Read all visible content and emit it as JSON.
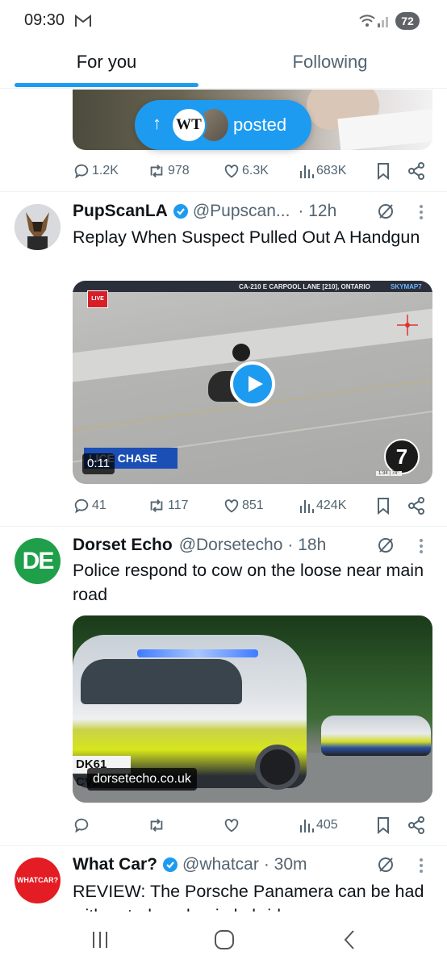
{
  "status_bar": {
    "time": "09:30",
    "battery": "72"
  },
  "tabs": [
    {
      "label": "For you",
      "active": true
    },
    {
      "label": "Following",
      "active": false
    }
  ],
  "posted_pill": {
    "avatar_text": "WT",
    "label": "posted"
  },
  "post0": {
    "replies": "1.2K",
    "reposts": "978",
    "likes": "6.3K",
    "views": "683K"
  },
  "post1": {
    "name": "PupScanLA",
    "handle": "@Pupscan...",
    "time": "· 12h",
    "text": "Replay When Suspect Pulled Out A Handgun",
    "video": {
      "live": "LIVE",
      "caption": "CA-210 E CARPOOL LANE [210], ONTARIO",
      "brand": "SKYMAP7",
      "banner": "LICE CHASE",
      "duration": "0:11",
      "station": "7",
      "station_time": "1:34 | 74°"
    },
    "replies": "41",
    "reposts": "117",
    "likes": "851",
    "views": "424K"
  },
  "post2": {
    "avatar_text": "DE",
    "name": "Dorset Echo",
    "handle": "@Dorsetecho",
    "time": "· 18h",
    "text": "Police respond to cow on the loose near main road",
    "image": {
      "plate": "DK61 CVZ",
      "source": "dorsetecho.co.uk"
    },
    "views": "405"
  },
  "post3": {
    "avatar_text": "WHATCAR?",
    "name": "What Car?",
    "handle": "@whatcar",
    "time": "· 30m",
    "text": "REVIEW: The Porsche Panamera can be had with petrol or plug-in hybrid power"
  },
  "colors": {
    "accent": "#1d9bf0",
    "secondary_text": "#536471",
    "dorset_green": "#1f9f4a",
    "whatcar_red": "#e31d23"
  }
}
